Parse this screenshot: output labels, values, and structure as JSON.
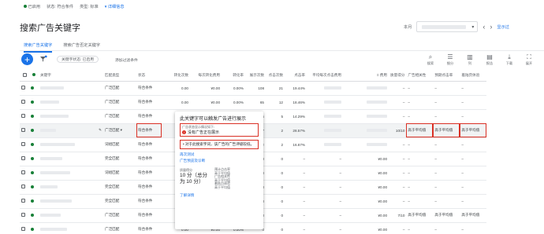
{
  "status_bar": {
    "status": "已启用",
    "state_label": "状态:",
    "state_value": "符合条件",
    "type_label": "类型:",
    "type_value": "标准",
    "details_link": "详细信息"
  },
  "page_title": "搜索广告关键字",
  "date": {
    "label": "本月"
  },
  "tabs": [
    {
      "label": "搜索广告关键字",
      "active": true
    },
    {
      "label": "搜索广告否定关键字",
      "active": false
    }
  ],
  "filter": {
    "chip": "关键字状态: 已启用",
    "add": "添加过滤条件"
  },
  "toolbar": [
    {
      "icon": "search-icon",
      "label": "搜索"
    },
    {
      "icon": "segment-icon",
      "label": "细分"
    },
    {
      "icon": "columns-icon",
      "label": "列"
    },
    {
      "icon": "reports-icon",
      "label": "报告"
    },
    {
      "icon": "download-icon",
      "label": "下载"
    },
    {
      "icon": "expand-icon",
      "label": "展开"
    }
  ],
  "columns": [
    "关键字",
    "匹配类型",
    "状态",
    "转化次数",
    "每次转化费用",
    "转化率",
    "展示次数",
    "点击次数",
    "点击率",
    "平均每次点击费用",
    "≡ 费用",
    "质量得分",
    "广告相关性",
    "预期点击率",
    "着陆页体验"
  ],
  "rows": [
    {
      "match": "广泛匹配",
      "status": "符合条件",
      "conv": "0.00",
      "cpa": "¥0.00",
      "cr": "0.00%",
      "impr": "108",
      "clicks": "21",
      "ctr": "19.44%",
      "cpc": "",
      "cost": "",
      "qs": "–",
      "rel": "–",
      "ectr": "–",
      "lp": "–"
    },
    {
      "match": "广泛匹配",
      "status": "符合条件",
      "conv": "0.00",
      "cpa": "¥0.00",
      "cr": "0.00%",
      "impr": "65",
      "clicks": "12",
      "ctr": "18.46%",
      "cpc": "",
      "cost": "",
      "qs": "–",
      "rel": "–",
      "ectr": "–",
      "lp": "–"
    },
    {
      "match": "广泛匹配",
      "status": "符合条件",
      "conv": "0.00",
      "cpa": "¥0.00",
      "cr": "0.00%",
      "impr": "35",
      "clicks": "5",
      "ctr": "14.29%",
      "cpc": "",
      "cost": "",
      "qs": "–",
      "rel": "–",
      "ectr": "–",
      "lp": "–"
    },
    {
      "match": "广泛匹配",
      "status": "符合条件",
      "conv": "0.00",
      "cpa": "¥0.00",
      "cr": "0.00%",
      "impr": "7",
      "clicks": "2",
      "ctr": "28.57%",
      "cpc": "",
      "cost": "",
      "qs": "10/10",
      "rel": "高于平均值",
      "ectr": "高于平均值",
      "lp": "高于平均值",
      "highlight": true
    },
    {
      "match": "词组匹配",
      "status": "符合条件",
      "conv": "0.00",
      "cpa": "¥0.00",
      "cr": "0.00%",
      "impr": "12",
      "clicks": "2",
      "ctr": "16.67%",
      "cpc": "",
      "cost": "",
      "qs": "–",
      "rel": "–",
      "ectr": "–",
      "lp": "–"
    },
    {
      "match": "完全匹配",
      "status": "符合条件",
      "conv": "0.00",
      "cpa": "¥0.00",
      "cr": "0.00%",
      "impr": "0",
      "clicks": "0",
      "ctr": "–",
      "cpc": "–",
      "cost": "¥0.00",
      "qs": "–",
      "rel": "–",
      "ectr": "–",
      "lp": "–"
    },
    {
      "match": "词组匹配",
      "status": "符合条件",
      "conv": "0.00",
      "cpa": "¥0.00",
      "cr": "0.00%",
      "impr": "0",
      "clicks": "0",
      "ctr": "–",
      "cpc": "–",
      "cost": "¥0.00",
      "qs": "–",
      "rel": "–",
      "ectr": "–",
      "lp": "–"
    },
    {
      "match": "完全匹配",
      "status": "符合条件",
      "conv": "0.00",
      "cpa": "¥0.00",
      "cr": "0.00%",
      "impr": "0",
      "clicks": "0",
      "ctr": "–",
      "cpc": "–",
      "cost": "¥0.00",
      "qs": "–",
      "rel": "–",
      "ectr": "–",
      "lp": "–"
    },
    {
      "match": "完全匹配",
      "status": "符合条件",
      "conv": "0.00",
      "cpa": "¥0.00",
      "cr": "0.00%",
      "impr": "0",
      "clicks": "0",
      "ctr": "–",
      "cpc": "–",
      "cost": "¥0.00",
      "qs": "–",
      "rel": "–",
      "ectr": "–",
      "lp": "–"
    },
    {
      "match": "广泛匹配",
      "status": "符合条件",
      "conv": "0.00",
      "cpa": "¥0.00",
      "cr": "0.00%",
      "impr": "0",
      "clicks": "0",
      "ctr": "–",
      "cpc": "–",
      "cost": "¥0.00",
      "qs": "7/10",
      "rel": "高于平均值",
      "ectr": "高于平均值",
      "lp": "高于平均值"
    },
    {
      "match": "广泛匹配",
      "status": "符合条件",
      "conv": "0.00",
      "cpa": "¥0.00",
      "cr": "0.00%",
      "impr": "0",
      "clicks": "0",
      "ctr": "–",
      "cpc": "–",
      "cost": "¥0.00",
      "qs": "–",
      "rel": "–",
      "ectr": "–",
      "lp": "–"
    }
  ],
  "popup": {
    "title": "此关键字可以触发广告进行展示",
    "small": "广告状态显示情况如下:",
    "warn": "没有广告正在展示",
    "detail": "对于此搜索字词，该广告的广告评级较低。",
    "test_link": "再次测试",
    "preview_link": "广告预览及诊断",
    "qs_label": "质量得分",
    "qs_value": "10 分（总分为 10 分）",
    "ectr_label": "预计点击率",
    "ectr_value": "高于平均值",
    "rel_label": "广告相关性",
    "rel_value": "高于平均值",
    "lp_label": "着陆页体验",
    "lp_value": "高于平均值",
    "more_link": "了解详情"
  }
}
